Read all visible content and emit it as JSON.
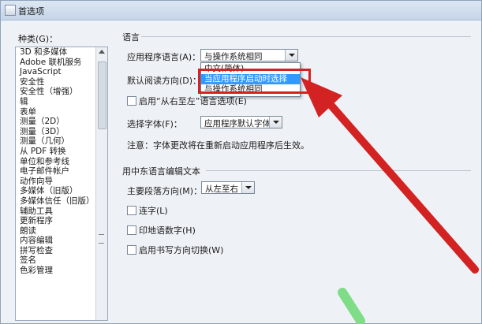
{
  "window": {
    "title": "首选项"
  },
  "sidebar": {
    "label": "种类(G)：",
    "items": [
      "3D 和多媒体",
      "Adobe 联机服务",
      "JavaScript",
      "安全性",
      "安全性（增强）",
      "辑",
      "表单",
      "测量（2D）",
      "测量（3D）",
      "测量（几何）",
      "从 PDF 转换",
      "单位和参考线",
      "电子邮件帐户",
      "动作向导",
      "多媒体（旧版）",
      "多媒体信任（旧版）",
      "辅助工具",
      "更新程序",
      "朗读",
      "内容编辑",
      "拼写检查",
      "签名",
      "色彩管理"
    ]
  },
  "language": {
    "section_title": "语言",
    "app_language_label": "应用程序语言(A)：",
    "app_language_value": "与操作系统相同",
    "reading_dir_label": "默认阅读方向(D)：",
    "rtl_option_label": "启用“从右至左”语言选项(E)",
    "font_label": "选择字体(F)：",
    "font_value": "应用程序默认字体",
    "note": "注意：字体更改将在重新启动应用程序后生效。"
  },
  "dropdown": {
    "options": [
      "中文(简体)",
      "当应用程序启动时选择",
      "与操作系统相同"
    ],
    "selected_index": 1
  },
  "middle_east": {
    "section_title": "用中东语言编辑文本",
    "paragraph_dir_label": "主要段落方向(M)：",
    "paragraph_dir_value": "从左至右",
    "ligature_label": "连字(L)",
    "hindi_digits_label": "印地语数字(H)",
    "keyboard_switch_label": "启用书写方向切换(W)"
  },
  "colors": {
    "annotation": "#d32222",
    "selection": "#3399ff"
  }
}
